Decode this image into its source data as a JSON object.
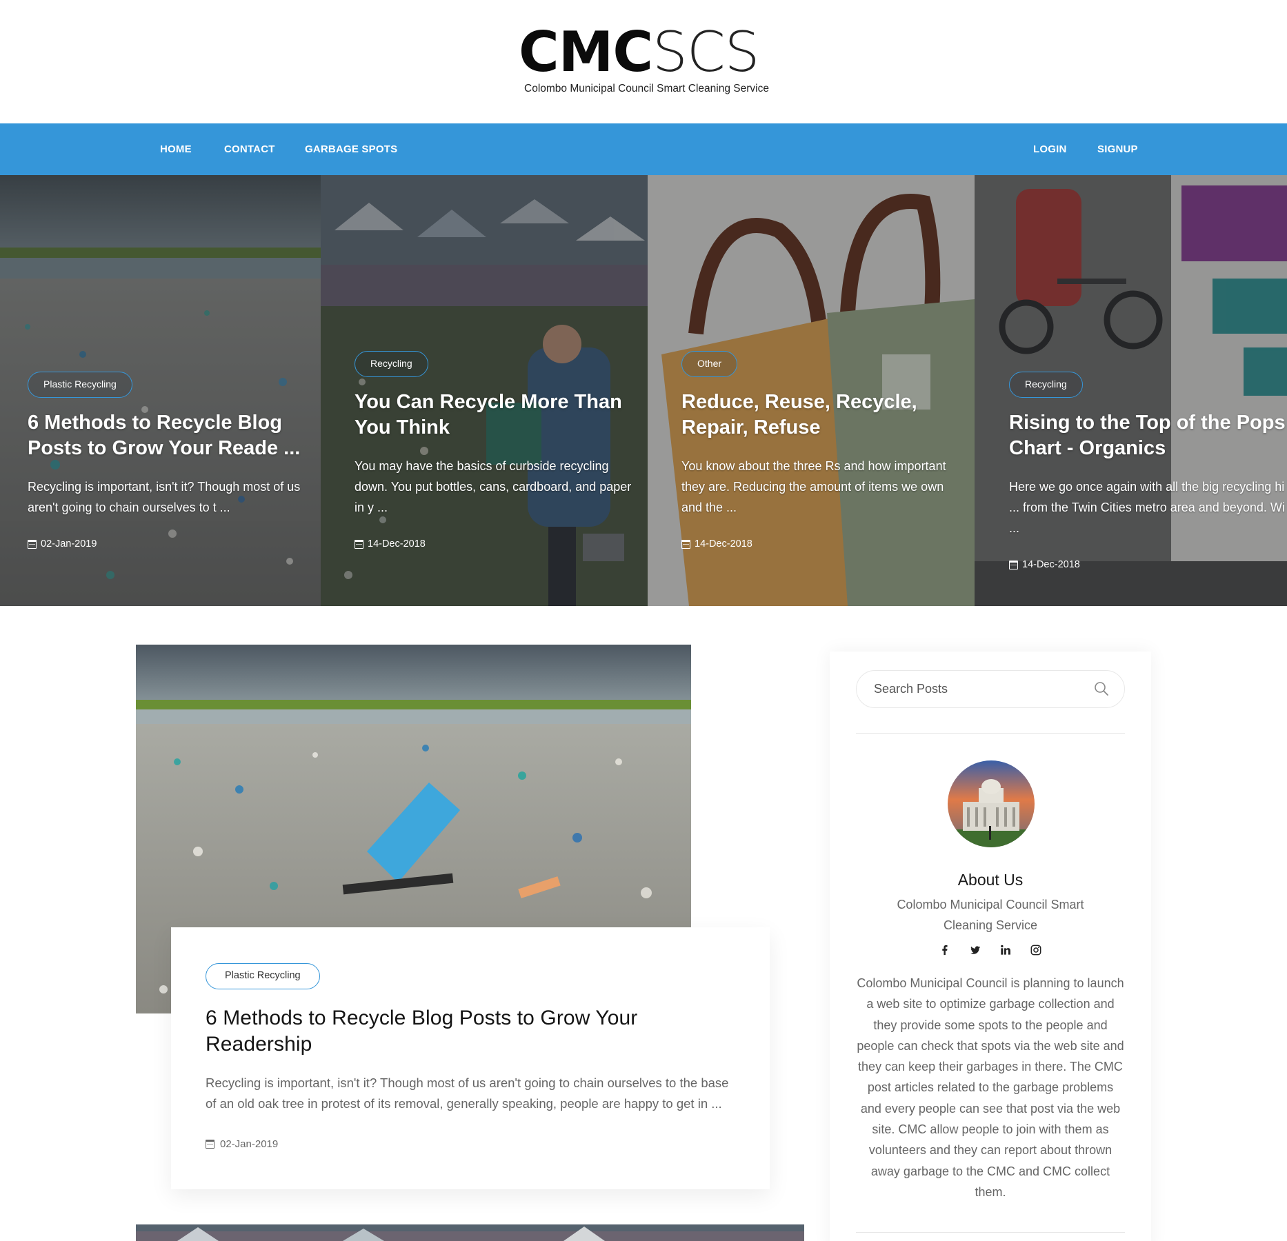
{
  "logo": {
    "bold": "CMC",
    "light": "SCS",
    "tagline": "Colombo Municipal Council Smart Cleaning Service"
  },
  "nav": {
    "home": "HOME",
    "contact": "CONTACT",
    "garbage_spots": "GARBAGE SPOTS",
    "login": "LOGIN",
    "signup": "SIGNUP",
    "color": "#3596d9"
  },
  "slider": [
    {
      "category": "Plastic Recycling",
      "title": "6 Methods to Recycle Blog Posts to Grow Your Reade ...",
      "excerpt": "Recycling is important, isn't it? Though most of us aren't going to chain ourselves to t ...",
      "date": "02-Jan-2019"
    },
    {
      "category": "Recycling",
      "title": "You Can Recycle More Than You Think",
      "excerpt": "You may have the basics of curbside recycling down. You put bottles, cans, cardboard, and paper in y ...",
      "date": "14-Dec-2018"
    },
    {
      "category": "Other",
      "title": "Reduce, Reuse, Recycle, Repair, Refuse",
      "excerpt": "You know about the three Rs and how important they are. Reducing the amount of items we own and the ...",
      "date": "14-Dec-2018"
    },
    {
      "category": "Recycling",
      "title": "Rising to the Top of the Pops Chart - Organics",
      "excerpt": "Here we go once again with all the big recycling hi ... from the Twin Cities metro area and beyond. Wi ...",
      "date": "14-Dec-2018"
    }
  ],
  "main_post": {
    "category": "Plastic Recycling",
    "title": "6 Methods to Recycle Blog Posts to Grow Your Readership",
    "excerpt": "Recycling is important, isn't it? Though most of us aren't going to chain ourselves to the base of an old oak tree in protest of its removal, generally speaking, people are happy to get in ...",
    "date": "02-Jan-2019"
  },
  "sidebar": {
    "search_placeholder": "Search Posts",
    "about_title": "About Us",
    "about_subtitle": "Colombo Municipal Council Smart Cleaning Service",
    "socials": [
      "facebook-icon",
      "twitter-icon",
      "linkedin-icon",
      "instagram-icon"
    ],
    "about_text": "Colombo Municipal Council is planning to launch a web site to optimize garbage collection and they provide some spots to the people and people can check that spots via the web site and they can keep their garbages in there. The CMC post articles related to the garbage problems and every people can see that post via the web site. CMC allow people to join with them as volunteers and they can report about thrown away garbage to the CMC and CMC collect them."
  }
}
